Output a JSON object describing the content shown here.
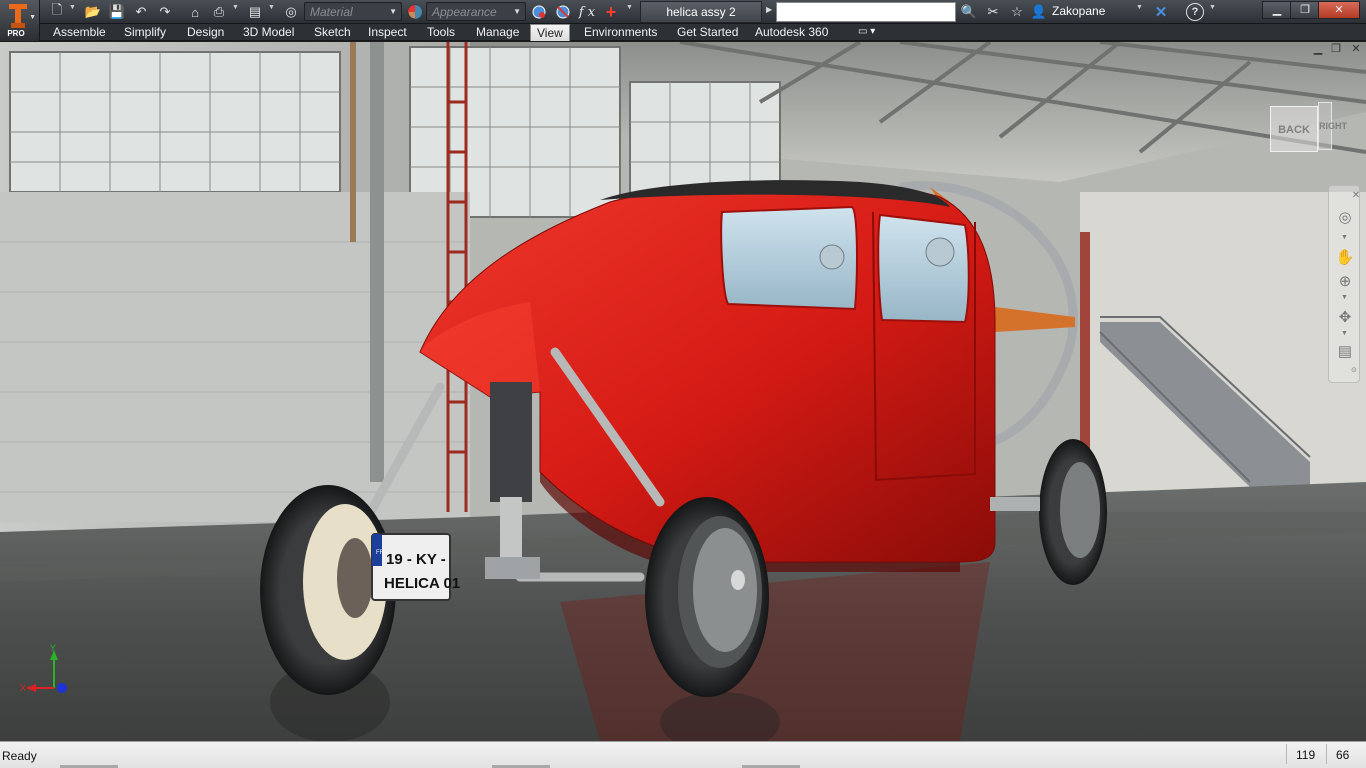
{
  "window": {
    "document_title": "helica assy 2",
    "user_name": "Zakopane",
    "app_badge": "PRO"
  },
  "quick_access": {
    "material_placeholder": "Material",
    "appearance_placeholder": "Appearance",
    "search_value": "",
    "fx_label": "f x"
  },
  "ribbon": {
    "tabs": [
      "Assemble",
      "Simplify",
      "Design",
      "3D Model",
      "Sketch",
      "Inspect",
      "Tools",
      "Manage",
      "View",
      "Environments",
      "Get Started",
      "Autodesk 360"
    ],
    "active_tab": "View"
  },
  "viewport": {
    "viewcube_face": "BACK",
    "viewcube_side": "RIGHT",
    "triad": {
      "x": "X",
      "y": "Y"
    },
    "license_plate": {
      "line1": "19 - KY -",
      "line2": "HELICA 01",
      "country": "FR"
    },
    "body_color": "#d41a14",
    "floor_color": "#4a4d4c"
  },
  "status_bar": {
    "text": "Ready",
    "count_a": "119",
    "count_b": "66"
  },
  "colors": {
    "title_bar": "#34383d",
    "accent_orange": "#e86a1a",
    "status_bar": "#e8e8e8"
  }
}
